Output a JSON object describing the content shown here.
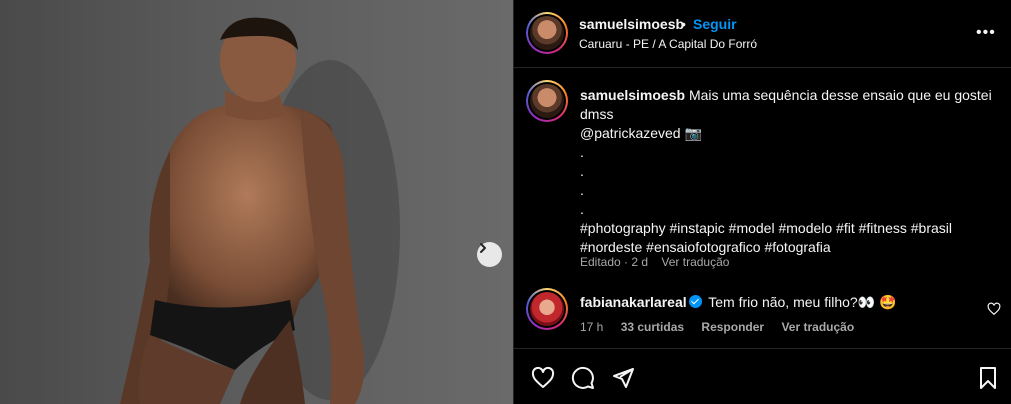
{
  "post": {
    "username": "samuelsimoesb",
    "dot": "•",
    "follow_label": "Seguir",
    "location": "Caruaru - PE / A Capital Do Forró",
    "more_label": "•••"
  },
  "caption": {
    "username": "samuelsimoesb",
    "line1": "Mais uma sequência desse ensaio que eu gostei",
    "line2": "dmss",
    "mention": "@patrickazeved 📷",
    "dot1": ".",
    "dot2": ".",
    "dot3": ".",
    "dot4": ".",
    "hashtags1": "#photography #instapic #model #modelo #fit #fitness #brasil",
    "hashtags2": "#nordeste #ensaiofotografico #fotografia",
    "edited": "Editado · 2 d",
    "see_translation": "Ver tradução"
  },
  "comment": {
    "username": "fabianakarlareal",
    "text": "Tem frio não, meu filho?👀 🤩",
    "time": "17 h",
    "likes": "33 curtidas",
    "reply": "Responder",
    "see_translation": "Ver tradução"
  },
  "colors": {
    "accent": "#0095f6",
    "background": "#000000",
    "muted_text": "#a8a8a8",
    "divider": "#262626"
  },
  "icons": [
    "more-icon",
    "next-arrow-icon",
    "heart-icon",
    "comment-icon",
    "share-icon",
    "save-icon",
    "verified-icon"
  ]
}
